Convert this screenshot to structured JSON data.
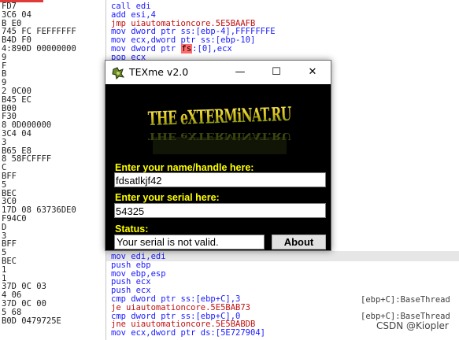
{
  "debugger": {
    "bytes_lines": [
      "FD7",
      "3C6 04",
      "B E0",
      "745 FC FEFFFFFF",
      "B4D F0",
      "4:890D 00000000",
      "9",
      "F",
      "B",
      "9",
      "2 0C00",
      "B45 EC",
      "B00",
      "F30",
      "8 0D000000",
      "3C4 04",
      "3",
      "B65 E8",
      "8 58FCFFFF",
      "C",
      "BFF",
      "5",
      "BEC",
      "3C0",
      "17D 08 63736DE0",
      "F94C0",
      "D",
      "3",
      "BFF",
      "5",
      "BEC",
      "1",
      "1",
      "37D 0C 03",
      "4 06",
      "37D 0C 00",
      "5 68",
      "B0D 0479725E"
    ],
    "code_top": [
      {
        "text": "call edi",
        "style": "blue"
      },
      {
        "text": "add esi,4",
        "style": "blue"
      },
      {
        "text": "jmp uiautomationcore.5E5BAAFB",
        "style": "red"
      },
      {
        "text": "mov dword ptr ss:[ebp-4],FFFFFFFE",
        "style": "blue"
      },
      {
        "text": "mov ecx,dword ptr ss:[ebp-10]",
        "style": "blue"
      },
      {
        "text_before": "mov dword ptr ",
        "fs": "fs",
        "text_after": ":[0],ecx",
        "style": "blue"
      },
      {
        "text": "pop ecx",
        "style": "blue"
      }
    ],
    "code_bottom": [
      {
        "text": "mov edi,edi",
        "style": "blue"
      },
      {
        "text": "push ebp",
        "style": "blue"
      },
      {
        "text": "mov ebp,esp",
        "style": "blue"
      },
      {
        "text": "push ecx",
        "style": "blue"
      },
      {
        "text": "push ecx",
        "style": "blue"
      },
      {
        "text": "cmp dword ptr ss:[ebp+C],3",
        "style": "blue"
      },
      {
        "text": "je uiautomationcore.5E5BAB73",
        "style": "red"
      },
      {
        "text": "cmp dword ptr ss:[ebp+C],0",
        "style": "blue"
      },
      {
        "text": "jne uiautomationcore.5E5BABDB",
        "style": "red"
      },
      {
        "text": "mov ecx,dword ptr ds:[5E727904]",
        "style": "blue"
      }
    ],
    "comments": [
      "[ebp+C]:BaseThread",
      "[ebp+C]:BaseThread"
    ],
    "watermark": "CSDN @Kiopler"
  },
  "window": {
    "title": "TEXme v2.0",
    "logo_text": "THE eXTERMiNATORS",
    "name_label": "Enter your name/handle here:",
    "name_value": "fdsatlkjf42",
    "serial_label": "Enter your serial here:",
    "serial_value": "54325",
    "status_label": "Status:",
    "status_value": "Your serial is not valid.",
    "about_label": "About",
    "controls": {
      "minimize": "—",
      "maximize": "☐",
      "close": "✕"
    }
  },
  "colors": {
    "label_yellow": "#ffff00",
    "window_bg": "#000000",
    "code_blue": "#1a1aff",
    "jump_red": "#c01010"
  }
}
